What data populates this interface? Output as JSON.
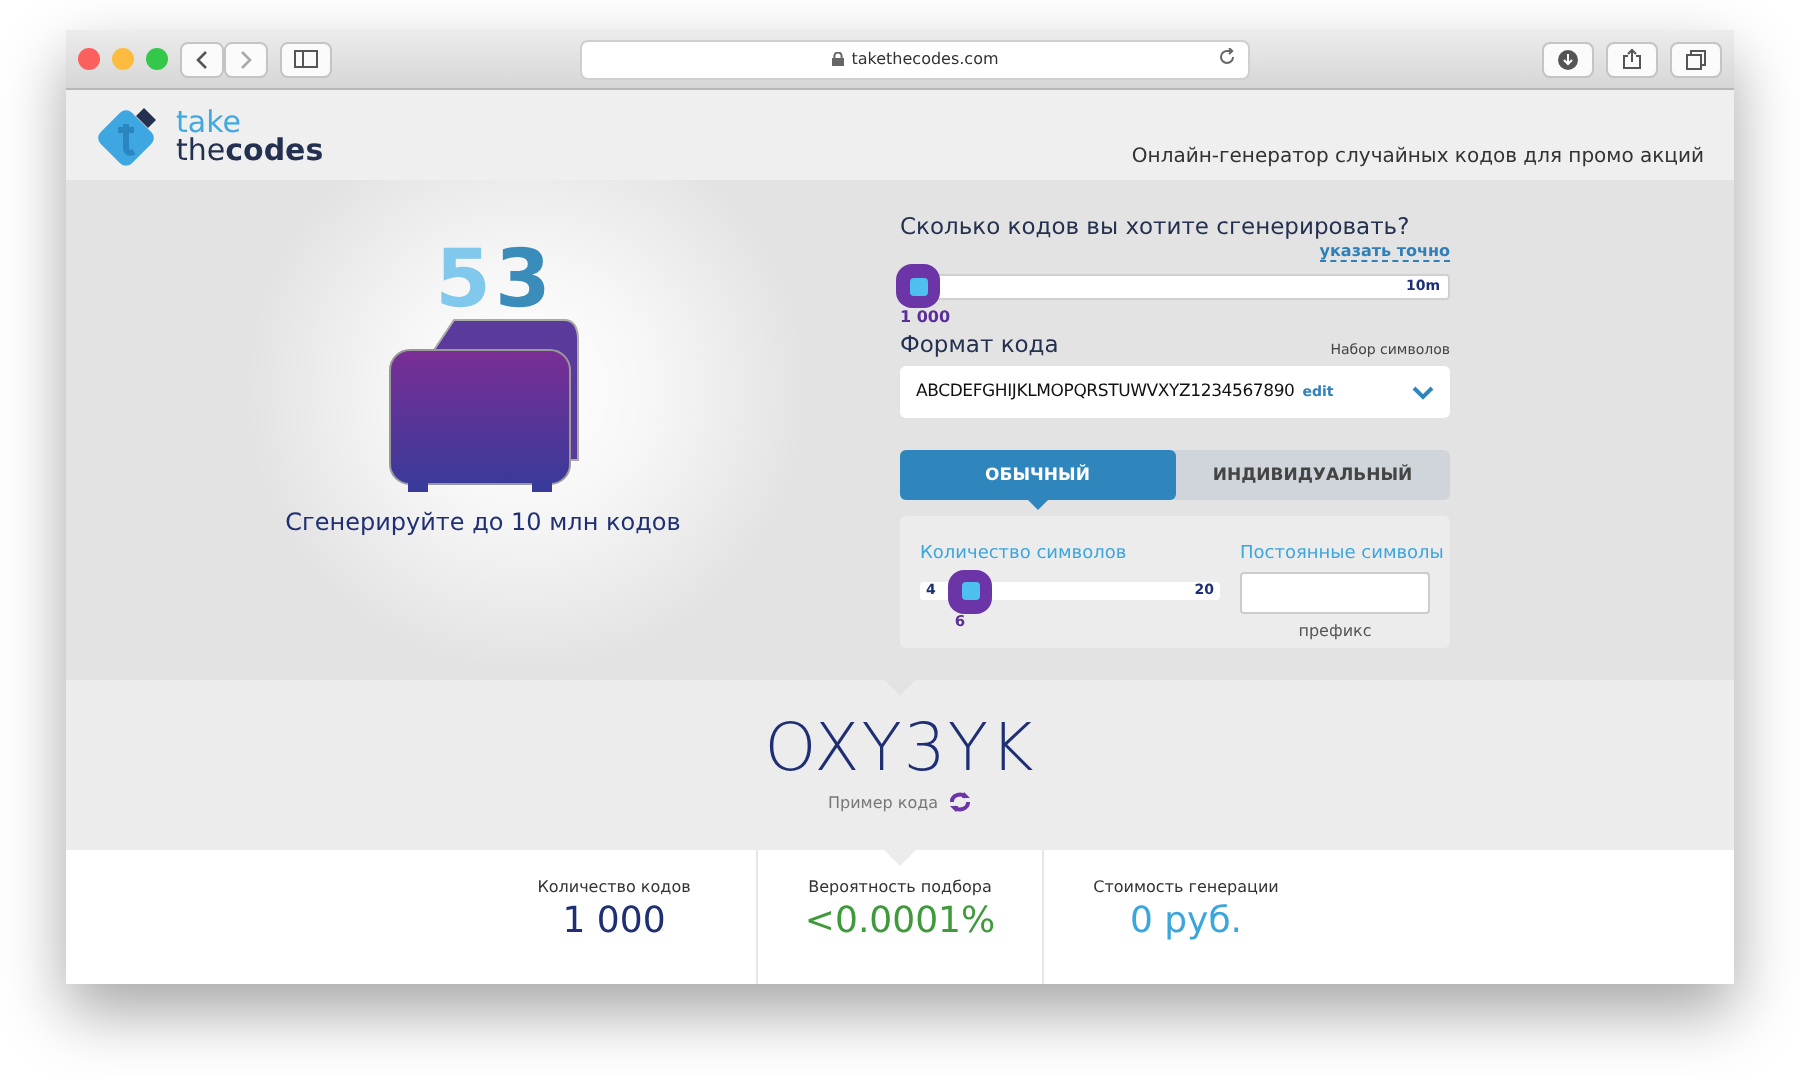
{
  "browser": {
    "url": "takethecodes.com"
  },
  "header": {
    "logo_top": "take",
    "logo_bottom_a": "the",
    "logo_bottom_b": "codes",
    "tagline": "Онлайн-генератор случайных кодов для промо акций"
  },
  "hero": {
    "illustration_cards": [
      "5",
      "3"
    ],
    "caption": "Сгенерируйте до 10 млн кодов"
  },
  "count": {
    "question": "Сколько кодов вы хотите сгенерировать?",
    "exact_link": "указать точно",
    "max_label": "10m",
    "level": 0,
    "reading": "1 000"
  },
  "format": {
    "label": "Формат кода",
    "charset_label": "Набор символов",
    "charset": "ABCDEFGHIJKLMOPQRSTUWVXYZ1234567890",
    "edit_link": "edit"
  },
  "tabs": [
    {
      "label": "ОБЫЧНЫЙ",
      "selected": true
    },
    {
      "label": "ИНДИВИДУАЛЬНЫЙ",
      "selected": false
    }
  ],
  "length": {
    "label": "Количество символов",
    "min_label": "4",
    "max_label": "20",
    "level": 0.125,
    "reading": "6"
  },
  "prefix": {
    "label": "Постоянные символы",
    "caption": "префикс"
  },
  "sample": {
    "code": "OXY3YK",
    "caption": "Пример кода"
  },
  "stats": [
    {
      "label": "Количество кодов",
      "value": "1 000",
      "color": "#1f2f73"
    },
    {
      "label": "Вероятность подбора",
      "value": "<0.0001%",
      "color": "#3f9a3c"
    },
    {
      "label": "Стоимость генерации",
      "value": "0 руб.",
      "color": "#3aa6dd"
    }
  ]
}
